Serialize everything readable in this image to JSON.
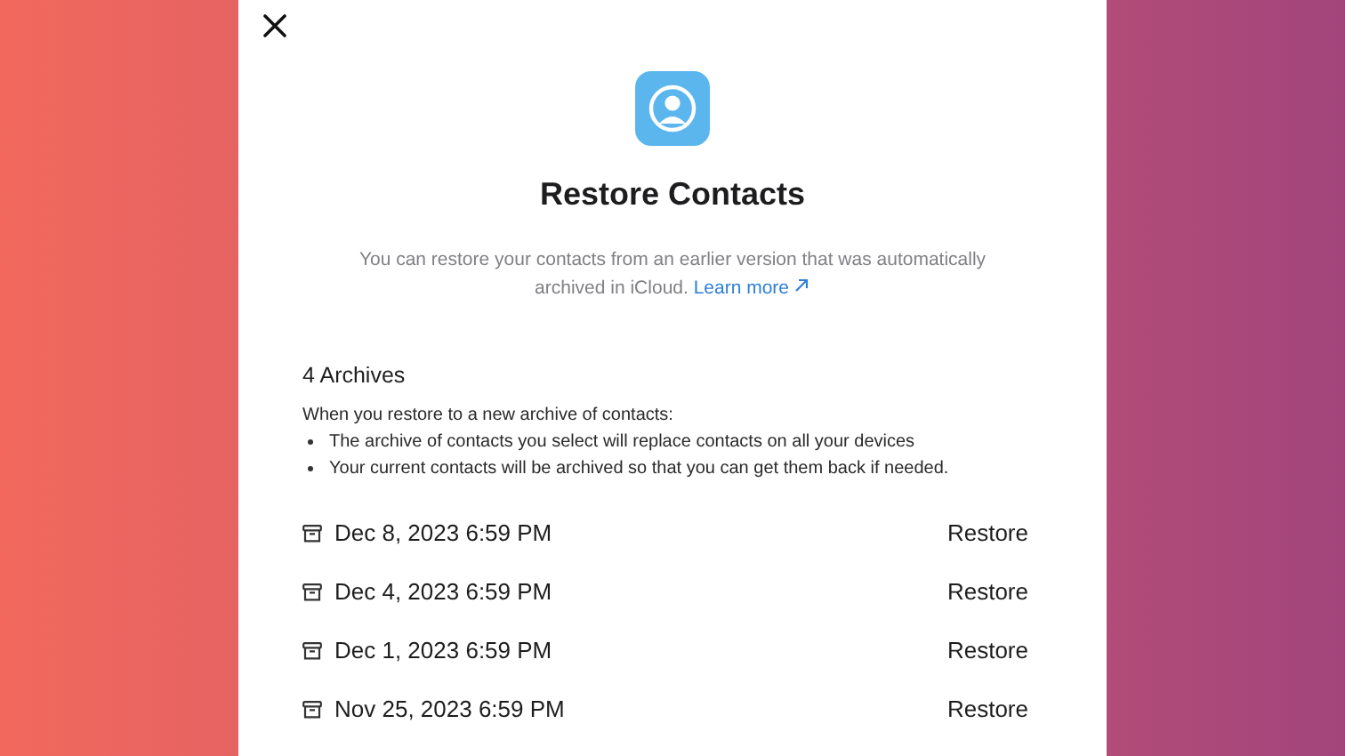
{
  "dialog": {
    "title": "Restore Contacts",
    "description": "You can restore your contacts from an earlier version that was automatically archived in iCloud.",
    "link": "Learn more",
    "archives_count": "4 Archives",
    "intro": "When you restore to a new archive of contacts:",
    "bullets": [
      "The archive of contacts you select will replace contacts on all your devices",
      "Your current contacts will be archived so that you can get them back if needed."
    ],
    "archives": [
      {
        "date": "Dec 8, 2023 6:59 PM",
        "action": "Restore"
      },
      {
        "date": "Dec 4, 2023 6:59 PM",
        "action": "Restore"
      },
      {
        "date": "Dec 1, 2023 6:59 PM",
        "action": "Restore"
      },
      {
        "date": "Nov 25, 2023 6:59 PM",
        "action": "Restore"
      }
    ]
  }
}
